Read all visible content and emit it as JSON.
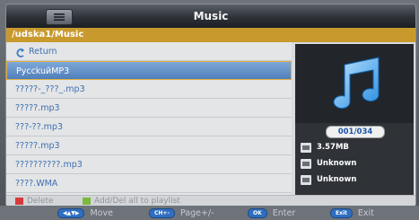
{
  "window": {
    "title": "Music"
  },
  "path": "/udska1/Music",
  "list": {
    "return_label": "Return",
    "items": [
      {
        "name": "PycckuйMP3",
        "selected": true
      },
      {
        "name": "?????-_???_.mp3",
        "selected": false
      },
      {
        "name": "?????.mp3",
        "selected": false
      },
      {
        "name": "???-??.mp3",
        "selected": false
      },
      {
        "name": "?????.mp3",
        "selected": false
      },
      {
        "name": "??????????.mp3",
        "selected": false
      },
      {
        "name": "????.WMA",
        "selected": false
      }
    ]
  },
  "side": {
    "art_icon": "music-note-icon",
    "counter": "001/034",
    "info": [
      {
        "icon": "file-size-icon",
        "value": "3.57MB"
      },
      {
        "icon": "artist-icon",
        "value": "Unknown"
      },
      {
        "icon": "album-icon",
        "value": "Unknown"
      }
    ]
  },
  "hints": {
    "delete_label": "Delete",
    "playlist_label": "Add/Del all to playlist",
    "delete_color": "#d63a3a",
    "playlist_color": "#7cb83a"
  },
  "keys": [
    {
      "pill": "◀▲▼▶",
      "label": "Move"
    },
    {
      "pill": "CH+-",
      "label": "Page+/-"
    },
    {
      "pill": "OK",
      "label": "Enter"
    },
    {
      "pill": "Exit",
      "label": "Exit"
    }
  ],
  "colors": {
    "accent": "#c89a2e",
    "selection": "#4f7fba",
    "link_text": "#3c6fb0"
  }
}
